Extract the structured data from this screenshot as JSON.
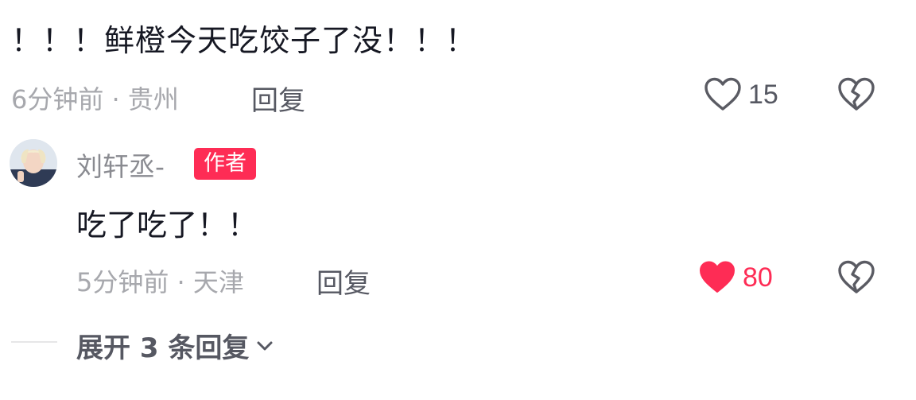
{
  "top_comment": {
    "text": "！！！鲜橙今天吃饺子了没！！！",
    "meta": "6分钟前 · 贵州",
    "reply_label": "回复",
    "like_count": "15",
    "liked": false
  },
  "reply": {
    "username": "刘轩丞-",
    "badge": "作者",
    "text": "吃了吃了！！",
    "meta": "5分钟前 · 天津",
    "reply_label": "回复",
    "like_count": "80",
    "liked": true
  },
  "expand": {
    "label": "展开 3 条回复"
  },
  "colors": {
    "accent": "#fe2c55",
    "text_primary": "#161823",
    "text_secondary": "#565862",
    "text_muted": "#a7a8ad"
  }
}
